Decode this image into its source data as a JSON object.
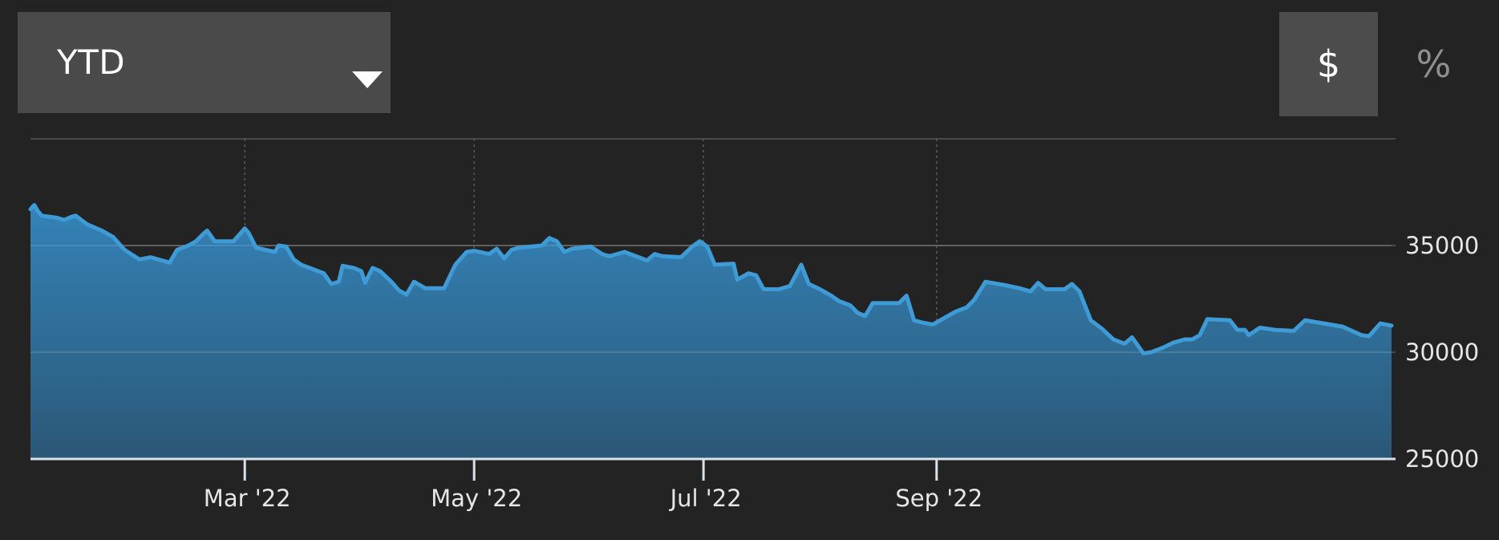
{
  "controls": {
    "range": {
      "label": "YTD",
      "icon": "caret-down-icon"
    },
    "modes": {
      "dollar_label": "$",
      "percent_label": "%",
      "active": "dollar"
    }
  },
  "colors": {
    "background": "#232323",
    "line": "#3f9bd6",
    "fill_top": "#3483b8",
    "fill_bottom": "#2b5776",
    "grid": "#4a4a4a",
    "axis": "#d9e2ea",
    "button": "#4a4a4a"
  },
  "chart_data": {
    "type": "area",
    "title": "",
    "xlabel": "",
    "ylabel": "",
    "ylim": [
      25000,
      40000
    ],
    "yticks": [
      25000,
      30000,
      35000
    ],
    "xlim": [
      "2022-01-03",
      "2022-09-30"
    ],
    "xticks": [
      {
        "date": "2022-03-01",
        "label": "Mar '22"
      },
      {
        "date": "2022-05-01",
        "label": "May '22"
      },
      {
        "date": "2022-07-01",
        "label": "Jul '22"
      },
      {
        "date": "2022-09-01",
        "label": "Sep '22"
      }
    ],
    "grid": true,
    "legend": "none",
    "series": [
      {
        "values": [
          [
            "2022-01-03",
            36700
          ],
          [
            "2022-01-04",
            36900
          ],
          [
            "2022-01-05",
            36600
          ],
          [
            "2022-01-06",
            36400
          ],
          [
            "2022-01-10",
            36300
          ],
          [
            "2022-01-12",
            36200
          ],
          [
            "2022-01-14",
            36350
          ],
          [
            "2022-01-15",
            36400
          ],
          [
            "2022-01-18",
            36000
          ],
          [
            "2022-01-22",
            35700
          ],
          [
            "2022-01-25",
            35400
          ],
          [
            "2022-01-28",
            34800
          ],
          [
            "2022-02-01",
            34350
          ],
          [
            "2022-02-04",
            34450
          ],
          [
            "2022-02-07",
            34300
          ],
          [
            "2022-02-09",
            34200
          ],
          [
            "2022-02-11",
            34800
          ],
          [
            "2022-02-14",
            35000
          ],
          [
            "2022-02-16",
            35200
          ],
          [
            "2022-02-18",
            35550
          ],
          [
            "2022-02-19",
            35700
          ],
          [
            "2022-02-21",
            35200
          ],
          [
            "2022-02-26",
            35200
          ],
          [
            "2022-03-01",
            35800
          ],
          [
            "2022-03-02",
            35600
          ],
          [
            "2022-03-04",
            34900
          ],
          [
            "2022-03-09",
            34700
          ],
          [
            "2022-03-10",
            35000
          ],
          [
            "2022-03-12",
            34950
          ],
          [
            "2022-03-14",
            34350
          ],
          [
            "2022-03-16",
            34100
          ],
          [
            "2022-03-22",
            33700
          ],
          [
            "2022-03-24",
            33200
          ],
          [
            "2022-03-26",
            33300
          ],
          [
            "2022-03-27",
            34050
          ],
          [
            "2022-03-30",
            33950
          ],
          [
            "2022-04-01",
            33800
          ],
          [
            "2022-04-02",
            33250
          ],
          [
            "2022-04-04",
            33950
          ],
          [
            "2022-04-06",
            33800
          ],
          [
            "2022-04-09",
            33300
          ],
          [
            "2022-04-11",
            32900
          ],
          [
            "2022-04-13",
            32700
          ],
          [
            "2022-04-15",
            33300
          ],
          [
            "2022-04-18",
            33000
          ],
          [
            "2022-04-23",
            33000
          ],
          [
            "2022-04-26",
            34100
          ],
          [
            "2022-04-29",
            34700
          ],
          [
            "2022-05-01",
            34750
          ],
          [
            "2022-05-05",
            34600
          ],
          [
            "2022-05-07",
            34850
          ],
          [
            "2022-05-09",
            34400
          ],
          [
            "2022-05-11",
            34800
          ],
          [
            "2022-05-13",
            34900
          ],
          [
            "2022-05-19",
            35000
          ],
          [
            "2022-05-21",
            35350
          ],
          [
            "2022-05-23",
            35200
          ],
          [
            "2022-05-25",
            34700
          ],
          [
            "2022-05-27",
            34850
          ],
          [
            "2022-06-01",
            34950
          ],
          [
            "2022-06-04",
            34600
          ],
          [
            "2022-06-06",
            34500
          ],
          [
            "2022-06-10",
            34700
          ],
          [
            "2022-06-16",
            34300
          ],
          [
            "2022-06-18",
            34600
          ],
          [
            "2022-06-20",
            34500
          ],
          [
            "2022-06-25",
            34450
          ],
          [
            "2022-06-28",
            34950
          ],
          [
            "2022-06-30",
            35200
          ],
          [
            "2022-07-02",
            34950
          ],
          [
            "2022-07-04",
            34100
          ],
          [
            "2022-07-09",
            34150
          ],
          [
            "2022-07-10",
            33400
          ],
          [
            "2022-07-13",
            33700
          ],
          [
            "2022-07-15",
            33600
          ],
          [
            "2022-07-17",
            32950
          ],
          [
            "2022-07-21",
            32950
          ],
          [
            "2022-07-24",
            33100
          ],
          [
            "2022-07-27",
            34100
          ],
          [
            "2022-07-29",
            33200
          ],
          [
            "2022-08-01",
            32950
          ],
          [
            "2022-08-04",
            32650
          ],
          [
            "2022-08-06",
            32400
          ],
          [
            "2022-08-09",
            32200
          ],
          [
            "2022-08-11",
            31850
          ],
          [
            "2022-08-13",
            31700
          ],
          [
            "2022-08-15",
            32300
          ],
          [
            "2022-08-18",
            32300
          ],
          [
            "2022-08-22",
            32300
          ],
          [
            "2022-08-24",
            32650
          ],
          [
            "2022-08-26",
            31500
          ],
          [
            "2022-08-28",
            31400
          ],
          [
            "2022-08-31",
            31300
          ],
          [
            "2022-09-03",
            31600
          ],
          [
            "2022-09-06",
            31900
          ],
          [
            "2022-09-09",
            32100
          ],
          [
            "2022-09-11",
            32450
          ],
          [
            "2022-09-14",
            33300
          ],
          [
            "2022-09-19",
            33150
          ],
          [
            "2022-09-23",
            33000
          ],
          [
            "2022-09-26",
            32850
          ],
          [
            "2022-09-28",
            33250
          ],
          [
            "2022-09-30",
            32950
          ],
          [
            "2022-10-02",
            32950
          ],
          [
            "2022-10-05",
            32950
          ],
          [
            "2022-10-07",
            33200
          ],
          [
            "2022-10-09",
            32850
          ],
          [
            "2022-10-12",
            31500
          ],
          [
            "2022-10-15",
            31100
          ],
          [
            "2022-10-18",
            30600
          ],
          [
            "2022-10-21",
            30400
          ],
          [
            "2022-10-23",
            30700
          ],
          [
            "2022-10-26",
            29950
          ],
          [
            "2022-10-28",
            30000
          ],
          [
            "2022-10-31",
            30200
          ],
          [
            "2022-11-03",
            30450
          ],
          [
            "2022-11-06",
            30600
          ],
          [
            "2022-11-08",
            30600
          ],
          [
            "2022-11-10",
            30800
          ],
          [
            "2022-11-12",
            31550
          ],
          [
            "2022-11-18",
            31500
          ],
          [
            "2022-11-20",
            31050
          ],
          [
            "2022-11-22",
            31050
          ],
          [
            "2022-11-23",
            30800
          ],
          [
            "2022-11-26",
            31150
          ],
          [
            "2022-11-30",
            31050
          ],
          [
            "2022-12-05",
            31000
          ],
          [
            "2022-12-08",
            31500
          ],
          [
            "2022-12-13",
            31350
          ],
          [
            "2022-12-18",
            31200
          ],
          [
            "2022-12-23",
            30800
          ],
          [
            "2022-12-25",
            30750
          ],
          [
            "2022-12-28",
            31350
          ],
          [
            "2022-12-31",
            31250
          ]
        ]
      }
    ]
  }
}
